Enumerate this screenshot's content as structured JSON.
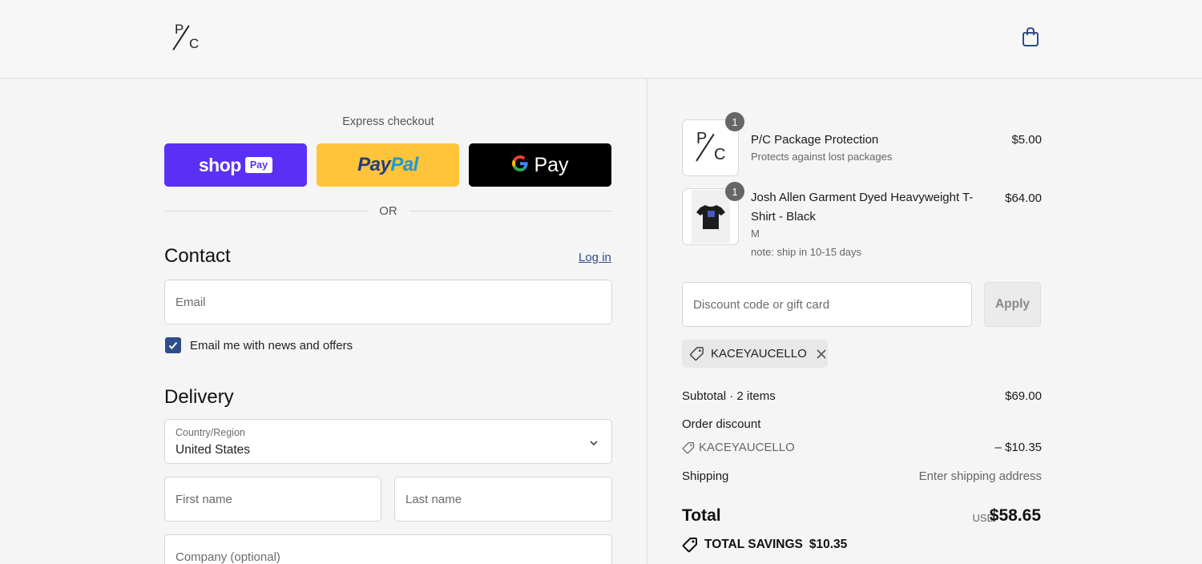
{
  "header": {
    "logo_p": "P",
    "logo_c": "C"
  },
  "express": {
    "label": "Express checkout",
    "shop_pay": {
      "word": "shop",
      "chip": "Pay"
    },
    "paypal": {
      "part1": "Pay",
      "part2": "Pal"
    },
    "gpay": {
      "g": "G",
      "word": "Pay"
    }
  },
  "divider": {
    "or": "OR"
  },
  "contact": {
    "title": "Contact",
    "login_link": "Log in",
    "email_placeholder": "Email",
    "newsletter_label": "Email me with news and offers",
    "newsletter_checked": true
  },
  "delivery": {
    "title": "Delivery",
    "country_label": "Country/Region",
    "country_value": "United States",
    "first_name_placeholder": "First name",
    "last_name_placeholder": "Last name",
    "company_placeholder": "Company (optional)"
  },
  "order": {
    "items": [
      {
        "name": "P/C Package Protection",
        "subtitle": "Protects against lost packages",
        "price": "$5.00",
        "qty": "1"
      },
      {
        "name_line1": "Josh Allen Garment Dyed Heavyweight T-",
        "name_line2": "Shirt - Black",
        "variant": "M",
        "note": "note: ship in 10-15 days",
        "price": "$64.00",
        "qty": "1"
      }
    ],
    "discount_placeholder": "Discount code or gift card",
    "apply_label": "Apply",
    "applied_code": "KACEYAUCELLO",
    "subtotal_label": "Subtotal · 2 items",
    "subtotal_value": "$69.00",
    "order_discount_label": "Order discount",
    "discount_code": "KACEYAUCELLO",
    "discount_value": "– $10.35",
    "shipping_label": "Shipping",
    "shipping_value": "Enter shipping address",
    "total_label": "Total",
    "total_currency": "USD",
    "total_value": "$58.65",
    "savings_label": "TOTAL SAVINGS",
    "savings_value": "$10.35"
  },
  "colors": {
    "accent": "#2f4d8a",
    "shop_pay": "#5a31f4",
    "paypal": "#ffc439",
    "gpay": "#000000"
  }
}
